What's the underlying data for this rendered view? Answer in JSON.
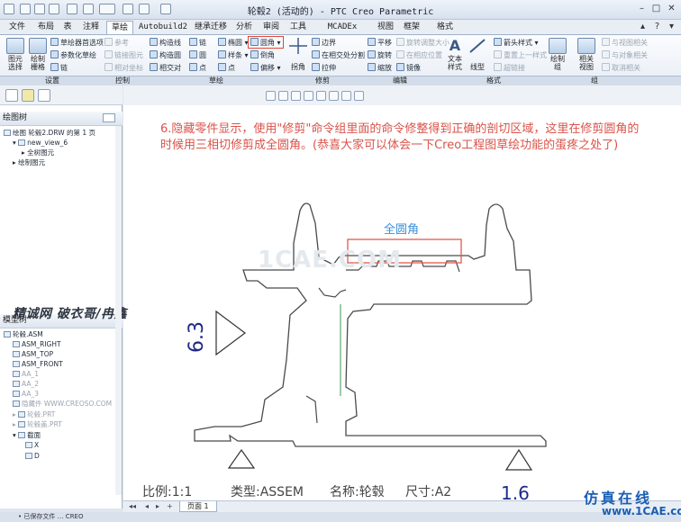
{
  "window": {
    "title": "轮毂2 (活动的) - PTC Creo Parametric",
    "buttons": [
      "minimize",
      "maximize",
      "close"
    ]
  },
  "menubar": {
    "file": "文件",
    "tabs": [
      "布局",
      "表",
      "注释",
      "草绘",
      "Autobuild2",
      "继承迁移",
      "分析",
      "审阅",
      "工具",
      "MCADEx Tools",
      "视图",
      "框架",
      "格式"
    ],
    "active": "草绘"
  },
  "ribbon": {
    "big_buttons": [
      {
        "label1": "图元",
        "label2": "选择"
      },
      {
        "label1": "绘制",
        "label2": "栅格"
      },
      {
        "label1": "",
        "label2": "拐角"
      },
      {
        "label1": "文本",
        "label2": "样式"
      },
      {
        "label1": "",
        "label2": "线型"
      },
      {
        "label1": "绘制",
        "label2": "组"
      },
      {
        "label1": "相关",
        "label2": "视图"
      }
    ],
    "commands": [
      {
        "label": "草绘器首选项",
        "enabled": true
      },
      {
        "label": "参数化草绘",
        "enabled": true
      },
      {
        "label": "链",
        "enabled": true
      },
      {
        "label": "参考",
        "enabled": false
      },
      {
        "label": "链接图元",
        "enabled": false
      },
      {
        "label": "相对坐标",
        "enabled": false
      },
      {
        "label": "构造线",
        "enabled": true
      },
      {
        "label": "构造圆",
        "enabled": true
      },
      {
        "label": "相交对",
        "enabled": true
      },
      {
        "label": "链",
        "enabled": true
      },
      {
        "label": "圆",
        "enabled": true
      },
      {
        "label": "点",
        "enabled": true
      },
      {
        "label": "椭圆",
        "enabled": true
      },
      {
        "label": "样条",
        "enabled": true
      },
      {
        "label": "点",
        "enabled": true
      },
      {
        "label": "圆角",
        "enabled": true
      },
      {
        "label": "倒角",
        "enabled": true
      },
      {
        "label": "偏移",
        "enabled": true
      },
      {
        "label": "边界",
        "enabled": true
      },
      {
        "label": "在相交处分割",
        "enabled": true
      },
      {
        "label": "拉伸",
        "enabled": true
      },
      {
        "label": "平移",
        "enabled": true
      },
      {
        "label": "旋转",
        "enabled": true
      },
      {
        "label": "缩放",
        "enabled": true
      },
      {
        "label": "旋转调整大小",
        "enabled": false
      },
      {
        "label": "在相应位置",
        "enabled": false
      },
      {
        "label": "镜像",
        "enabled": true
      },
      {
        "label": "箭头样式",
        "enabled": true
      },
      {
        "label": "重置上一样式",
        "enabled": false
      },
      {
        "label": "超链接",
        "enabled": false
      },
      {
        "label": "与视图相关",
        "enabled": false
      },
      {
        "label": "与对象相关",
        "enabled": false
      },
      {
        "label": "取消相关",
        "enabled": false
      }
    ],
    "groups": [
      "设置",
      "控制",
      "草绘",
      "修剪",
      "编辑",
      "格式",
      "组"
    ]
  },
  "left_panel": {
    "drawing_tree_title": "绘图树",
    "drawing_tree": [
      {
        "label": "绘图 轮毂2.DRW 的第 1 页",
        "indent": 0
      },
      {
        "label": "new_view_6",
        "indent": 1
      },
      {
        "label": "全树图元",
        "indent": 2
      },
      {
        "label": "绘制图元",
        "indent": 1
      }
    ],
    "model_tree_title": "模型树",
    "model_tree": [
      {
        "label": "轮毂.ASM",
        "indent": 0,
        "dim": false
      },
      {
        "label": "ASM_RIGHT",
        "indent": 1,
        "dim": false
      },
      {
        "label": "ASM_TOP",
        "indent": 1,
        "dim": false
      },
      {
        "label": "ASM_FRONT",
        "indent": 1,
        "dim": false
      },
      {
        "label": "AA_1",
        "indent": 1,
        "dim": true
      },
      {
        "label": "AA_2",
        "indent": 1,
        "dim": true
      },
      {
        "label": "AA_3",
        "indent": 1,
        "dim": true
      },
      {
        "label": "隐藏件 WWW.CREOSO.COM",
        "indent": 1,
        "dim": true
      },
      {
        "label": "轮毂.PRT",
        "indent": 1,
        "dim": true
      },
      {
        "label": "轮毂盖.PRT",
        "indent": 1,
        "dim": true
      },
      {
        "label": "截面",
        "indent": 1,
        "dim": false
      },
      {
        "label": "X",
        "indent": 2,
        "dim": false
      },
      {
        "label": "D",
        "indent": 2,
        "dim": false
      }
    ]
  },
  "canvas": {
    "annotation": "6.隐藏零件显示，使用\"修剪\"命令组里面的命令修整得到正确的剖切区域，这里在修剪圆角的时候用三相切修剪成全圆角。(恭喜大家可以体会一下Creo工程图草绘功能的蛋疼之处了)",
    "fillet_label": "全圆角",
    "watermark": "1CAE.COM",
    "overlay_text": "精诚网 破衣哥/冉鑫",
    "roughness_left": "6.3",
    "roughness_bottom": "1.6",
    "title_block": {
      "scale": "比例:1:1",
      "type": "类型:ASSEM",
      "name": "名称:轮毂",
      "size": "尺寸:A2"
    }
  },
  "bottom": {
    "page_tab": "页面 1",
    "status": "• 已保存文件 … CREO"
  },
  "brand": {
    "top": "仿真在线",
    "bottom": "www.1CAE.com"
  }
}
